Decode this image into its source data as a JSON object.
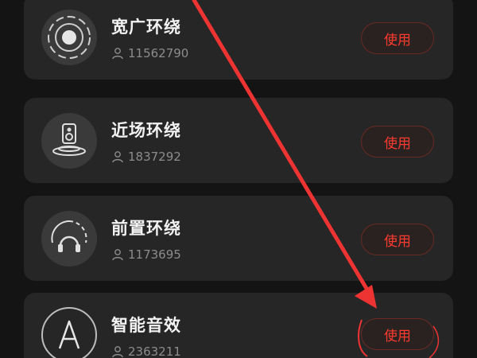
{
  "cards": [
    {
      "title": "宽广环绕",
      "count": "11562790",
      "button": "使用",
      "icon": "wide-surround-icon"
    },
    {
      "title": "近场环绕",
      "count": "1837292",
      "button": "使用",
      "icon": "nearfield-speaker-icon"
    },
    {
      "title": "前置环绕",
      "count": "1173695",
      "button": "使用",
      "icon": "headphones-front-icon"
    },
    {
      "title": "智能音效",
      "count": "2363211",
      "button": "使用",
      "icon": "smart-a-icon"
    }
  ],
  "colors": {
    "background": "#141414",
    "card": "#262626",
    "accent": "#ff3b2f",
    "annotation_arrow": "#ee3333"
  },
  "user_icon": "user-icon"
}
